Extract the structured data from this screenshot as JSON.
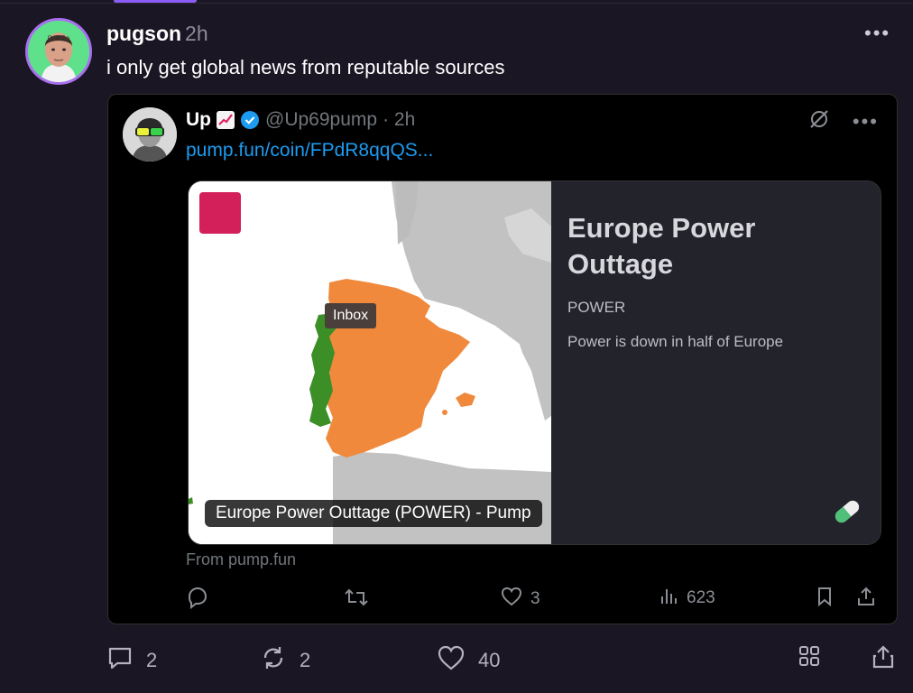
{
  "post": {
    "author": "pugson",
    "time": "2h",
    "text": "i only get global news from reputable sources",
    "avatar_label": "0x36e",
    "more": "•••"
  },
  "quote": {
    "name": "Up",
    "handle": "@Up69pump",
    "time": "· 2h",
    "link": "pump.fun/coin/FPdR8qqQS...",
    "more": "•••",
    "card": {
      "title": "Europe Power Outtage",
      "ticker": "POWER",
      "description": "Power is down in half of Europe",
      "tooltip": "Inbox",
      "caption": "Europe Power Outtage (POWER) - Pump"
    },
    "from": "From pump.fun",
    "likes": "3",
    "views": "623"
  },
  "post_actions": {
    "replies": "2",
    "reposts": "2",
    "likes": "40"
  },
  "colors": {
    "accent": "#a86ff0",
    "link": "#1d9bf0",
    "map_orange": "#f0893c",
    "map_green": "#3b8f26"
  }
}
